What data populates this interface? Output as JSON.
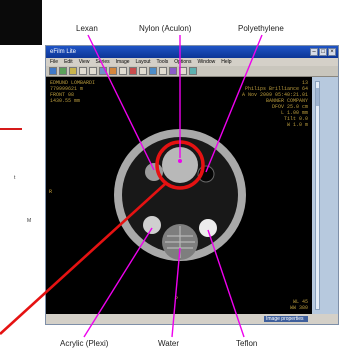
{
  "callouts": {
    "lexan": "Lexan",
    "nylon": "Nylon (Aculon)",
    "polyethylene": "Polyethylene",
    "acrylic": "Acrylic (Plexi)",
    "water": "Water",
    "teflon": "Teflon"
  },
  "left_fragments": {
    "line1": "t",
    "line2": "M"
  },
  "app_window": {
    "title": "eFilm Lite",
    "menu": [
      "File",
      "Edit",
      "View",
      "Series",
      "Image",
      "Layout",
      "Tools",
      "Options",
      "Window",
      "Help"
    ],
    "overlay_top_left": "EDMUND LOMBARDI\n779999621 m\nFRONT 08\n1430.55 mm",
    "overlay_top_right": "13\nPhilips Brilliance 64\nA Nov 2009 05:40:21.01\nBANNER COMPANY\nDFOV 25.0 cm\nL 1.00 mm\nTilt 0.0\nW 1.0 m",
    "overlay_bottom_right": "WL 45\nWW 380",
    "status_text": "Image properties"
  },
  "colors": {
    "magenta_lines": "#ee00ee",
    "red_highlight": "#e51212",
    "titlebar": "#1f54c6"
  }
}
